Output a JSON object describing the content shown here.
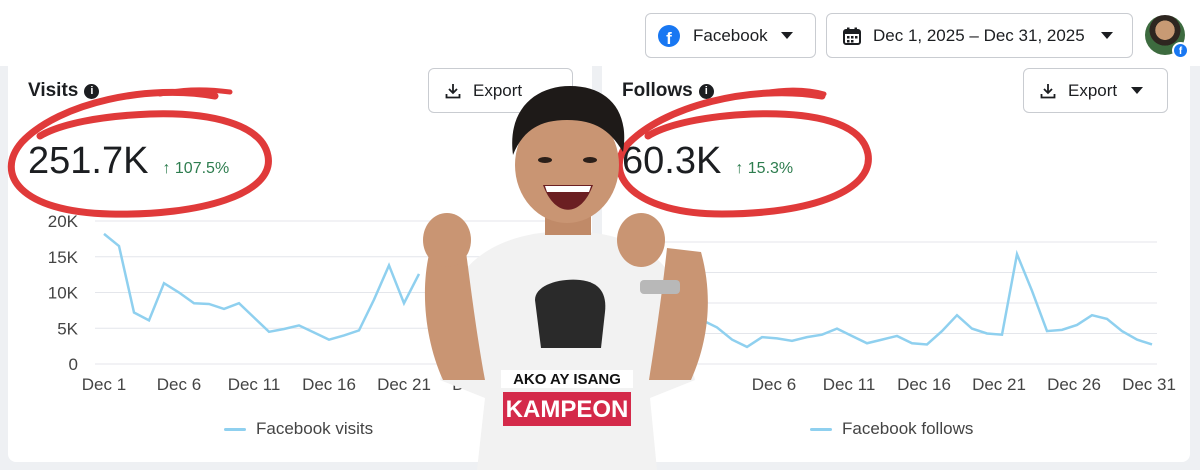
{
  "header": {
    "platform_selector": {
      "label": "Facebook",
      "icon": "facebook-icon"
    },
    "date_range": {
      "label": "Dec 1, 2025 – Dec 31, 2025",
      "icon": "calendar-icon"
    },
    "avatar": {
      "icon": "profile-avatar"
    }
  },
  "visits": {
    "title": "Visits",
    "export_label": "Export",
    "total": "251.7K",
    "change": "107.5%",
    "legend": "Facebook visits",
    "color": "#8fd0ef"
  },
  "follows": {
    "title": "Follows",
    "export_label": "Export",
    "total": "60.3K",
    "change": "15.3%",
    "legend": "Facebook follows",
    "color": "#8fd0ef"
  },
  "overlay": {
    "shirt_line1": "AKO AY ISANG",
    "shirt_line2": "KAMPEON",
    "ring_color": "#e03a3a"
  },
  "chart_data": [
    {
      "type": "line",
      "series": [
        {
          "name": "Facebook visits",
          "values": [
            18200,
            16500,
            7200,
            6100,
            11300,
            10000,
            8500,
            8400,
            7700,
            8500,
            6500,
            4500,
            4900,
            5400,
            4400,
            3400,
            4000,
            4700,
            9000,
            13800,
            8500,
            12600
          ]
        }
      ],
      "x_ticks": [
        "Dec 1",
        "Dec 6",
        "Dec 11",
        "Dec 16",
        "Dec 21",
        "Dec 26"
      ],
      "y_ticks": [
        "0",
        "5K",
        "10K",
        "15K",
        "20K"
      ],
      "ylim": [
        0,
        20000
      ]
    },
    {
      "type": "line",
      "series": [
        {
          "name": "Facebook follows",
          "values": [
            2000,
            1800,
            1500,
            1000,
            700,
            1100,
            1050,
            950,
            1100,
            1200,
            1450,
            1150,
            850,
            1000,
            1150,
            850,
            800,
            1350,
            2000,
            1450,
            1250,
            1200,
            4500,
            3000,
            1350,
            1400,
            1600,
            2000,
            1850,
            1350,
            1000,
            800
          ]
        }
      ],
      "x_ticks": [
        "Dec 6",
        "Dec 11",
        "Dec 16",
        "Dec 21",
        "Dec 26",
        "Dec 31"
      ]
    }
  ]
}
